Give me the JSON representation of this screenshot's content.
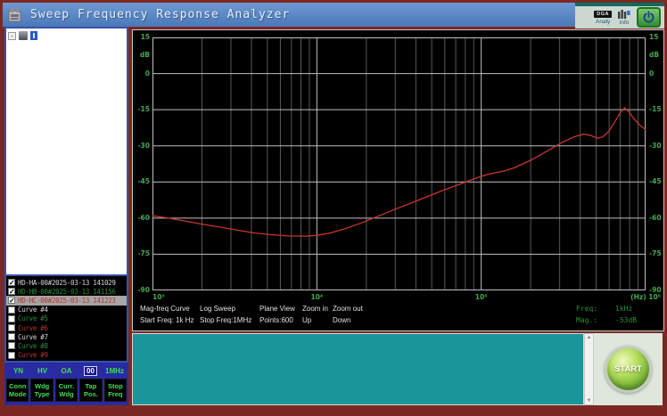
{
  "window": {
    "title": "Sweep Frequency Response Analyzer"
  },
  "topbar": {
    "dga_icon_text": "DGA",
    "dga_label": "Analy",
    "info_label": "Info"
  },
  "tree": {
    "expander_glyph": "-"
  },
  "curve_list": {
    "palette": {
      "white": "#d6d6d6",
      "green": "#2e8b3a",
      "red": "#b5352a",
      "selected_bg": "#a6a6a6"
    },
    "items": [
      {
        "label": "HD-HA-00#2025-03-13 141029",
        "checked": true,
        "color": "white",
        "selected": false
      },
      {
        "label": "HD-HB-00#2025-03-13 141156",
        "checked": true,
        "color": "green",
        "selected": false
      },
      {
        "label": "HD-HC-00#2025-03-13 141223",
        "checked": true,
        "color": "red",
        "selected": true
      },
      {
        "label": "Curve #4",
        "checked": false,
        "color": "white",
        "selected": false
      },
      {
        "label": "Curve #5",
        "checked": false,
        "color": "green",
        "selected": false
      },
      {
        "label": "Curve #6",
        "checked": false,
        "color": "red",
        "selected": false
      },
      {
        "label": "Curve #7",
        "checked": false,
        "color": "white",
        "selected": false
      },
      {
        "label": "Curve #8",
        "checked": false,
        "color": "green",
        "selected": false
      },
      {
        "label": "Curve #9",
        "checked": false,
        "color": "red",
        "selected": false
      }
    ]
  },
  "controls": {
    "status_values": [
      "YN",
      "HV",
      "OA",
      "00",
      "1MHz"
    ],
    "boxed_status_index": 3,
    "buttons": [
      {
        "line1": "Conn",
        "line2": "Mode"
      },
      {
        "line1": "Wdg",
        "line2": "Type"
      },
      {
        "line1": "Curr.",
        "line2": "Wdg"
      },
      {
        "line1": "Tap",
        "line2": "Pos."
      },
      {
        "line1": "Stop",
        "line2": "Freq"
      }
    ]
  },
  "chart_info": {
    "row1": [
      "Mag-freq Curve",
      "Log Sweep",
      "Plane View",
      "Zoom in",
      "Zoom out"
    ],
    "row2": [
      "Start Freq: 1k Hz",
      "Stop Freq:1MHz",
      "Points:600",
      "Up",
      "Down"
    ],
    "readout": {
      "freq_label": "Freq:",
      "freq_value": "1kHz",
      "mag_label": "Mag.:",
      "mag_value": "-53dB"
    }
  },
  "chart_data": {
    "type": "line",
    "title": "Sweep frequency response magnitude curve",
    "x_scale": "log",
    "xlim": [
      1000,
      1000000
    ],
    "ylim": [
      -90,
      15
    ],
    "y_unit": "dB",
    "x_unit": "(Hz)",
    "grid": true,
    "y_ticks": [
      15,
      0,
      -15,
      -30,
      -45,
      -60,
      -75,
      -90
    ],
    "x_tick_labels": [
      {
        "text": "10³",
        "freq": 1000
      },
      {
        "text": "10⁴",
        "freq": 10000
      },
      {
        "text": "10⁵",
        "freq": 100000
      },
      {
        "text": "(Hz) 10⁶",
        "freq": 1000000
      }
    ],
    "axis_color": "#45a94f",
    "curve_color": "#c8372d",
    "series": [
      {
        "name": "HD-HC-00#2025-03-13 141223",
        "points": [
          [
            1000,
            -59
          ],
          [
            1250,
            -60
          ],
          [
            1600,
            -61.3
          ],
          [
            2000,
            -62.5
          ],
          [
            2600,
            -63.8
          ],
          [
            3300,
            -65
          ],
          [
            4200,
            -66.2
          ],
          [
            5300,
            -66.9
          ],
          [
            6700,
            -67.4
          ],
          [
            8500,
            -67.5
          ],
          [
            10000,
            -67.2
          ],
          [
            12000,
            -66.2
          ],
          [
            15000,
            -64.3
          ],
          [
            19000,
            -61.8
          ],
          [
            24000,
            -59
          ],
          [
            30000,
            -56.3
          ],
          [
            38000,
            -53.6
          ],
          [
            48000,
            -50.8
          ],
          [
            60000,
            -48.2
          ],
          [
            75000,
            -45.8
          ],
          [
            95000,
            -43.2
          ],
          [
            110000,
            -41.8
          ],
          [
            125000,
            -41
          ],
          [
            140000,
            -40.3
          ],
          [
            160000,
            -39
          ],
          [
            200000,
            -36
          ],
          [
            250000,
            -32.3
          ],
          [
            310000,
            -28.6
          ],
          [
            370000,
            -26.2
          ],
          [
            420000,
            -25.2
          ],
          [
            460000,
            -25.6
          ],
          [
            510000,
            -26.8
          ],
          [
            550000,
            -26.3
          ],
          [
            600000,
            -23.8
          ],
          [
            650000,
            -20
          ],
          [
            700000,
            -16.3
          ],
          [
            745000,
            -14.2
          ],
          [
            790000,
            -15.8
          ],
          [
            850000,
            -18.8
          ],
          [
            920000,
            -21.3
          ],
          [
            1000000,
            -23.3
          ]
        ]
      }
    ]
  },
  "start_panel": {
    "start_label": "START"
  }
}
